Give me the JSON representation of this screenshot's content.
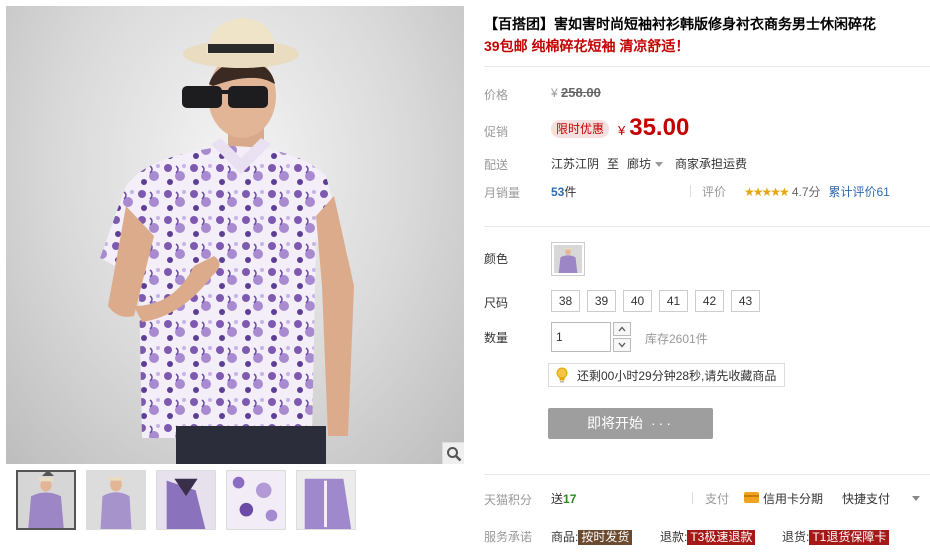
{
  "product": {
    "title": "【百搭团】害如害时尚短袖衬衫韩版修身衬衣商务男士休闲碎花",
    "subtitle": "39包邮 纯棉碎花短袖 清凉舒适！"
  },
  "price": {
    "label": "价格",
    "currency": "¥",
    "original": "258.00",
    "promo_label": "促销",
    "promo_tag": "限时优惠",
    "current": "35.00"
  },
  "shipping": {
    "label": "配送",
    "from": "江苏江阴",
    "to_word": "至",
    "destination": "廊坊",
    "fee": "商家承担运费"
  },
  "sales": {
    "label": "月销量",
    "count": "53",
    "unit": "件"
  },
  "rating": {
    "label": "评价",
    "stars": "★★★★★",
    "score": "4.7分",
    "total_link": "累计评价61"
  },
  "options": {
    "color_label": "颜色",
    "size_label": "尺码",
    "sizes": [
      "38",
      "39",
      "40",
      "41",
      "42",
      "43"
    ],
    "qty_label": "数量",
    "qty_value": "1",
    "stock": "库存2601件"
  },
  "countdown": {
    "text": "还剩00小时29分钟28秒,请先收藏商品"
  },
  "cta": {
    "label": "即将开始",
    "dots": "···"
  },
  "points": {
    "label": "天猫积分",
    "prefix": "送",
    "value": "17"
  },
  "payment": {
    "label": "支付",
    "credit": "信用卡分期",
    "quick": "快捷支付"
  },
  "service": {
    "label": "服务承诺",
    "goods_label": "商品:",
    "goods_tag": "按时发货",
    "refund_label": "退款:",
    "refund_tag": "T3极速退款",
    "return_label": "退货:",
    "return_tag": "T1退货保障卡"
  },
  "colors": {
    "accent_red": "#c40000",
    "link_blue": "#2d6ab0",
    "star_gold": "#e5a711",
    "cta_gray": "#9e9e9e",
    "points_green": "#2a8a1e"
  }
}
